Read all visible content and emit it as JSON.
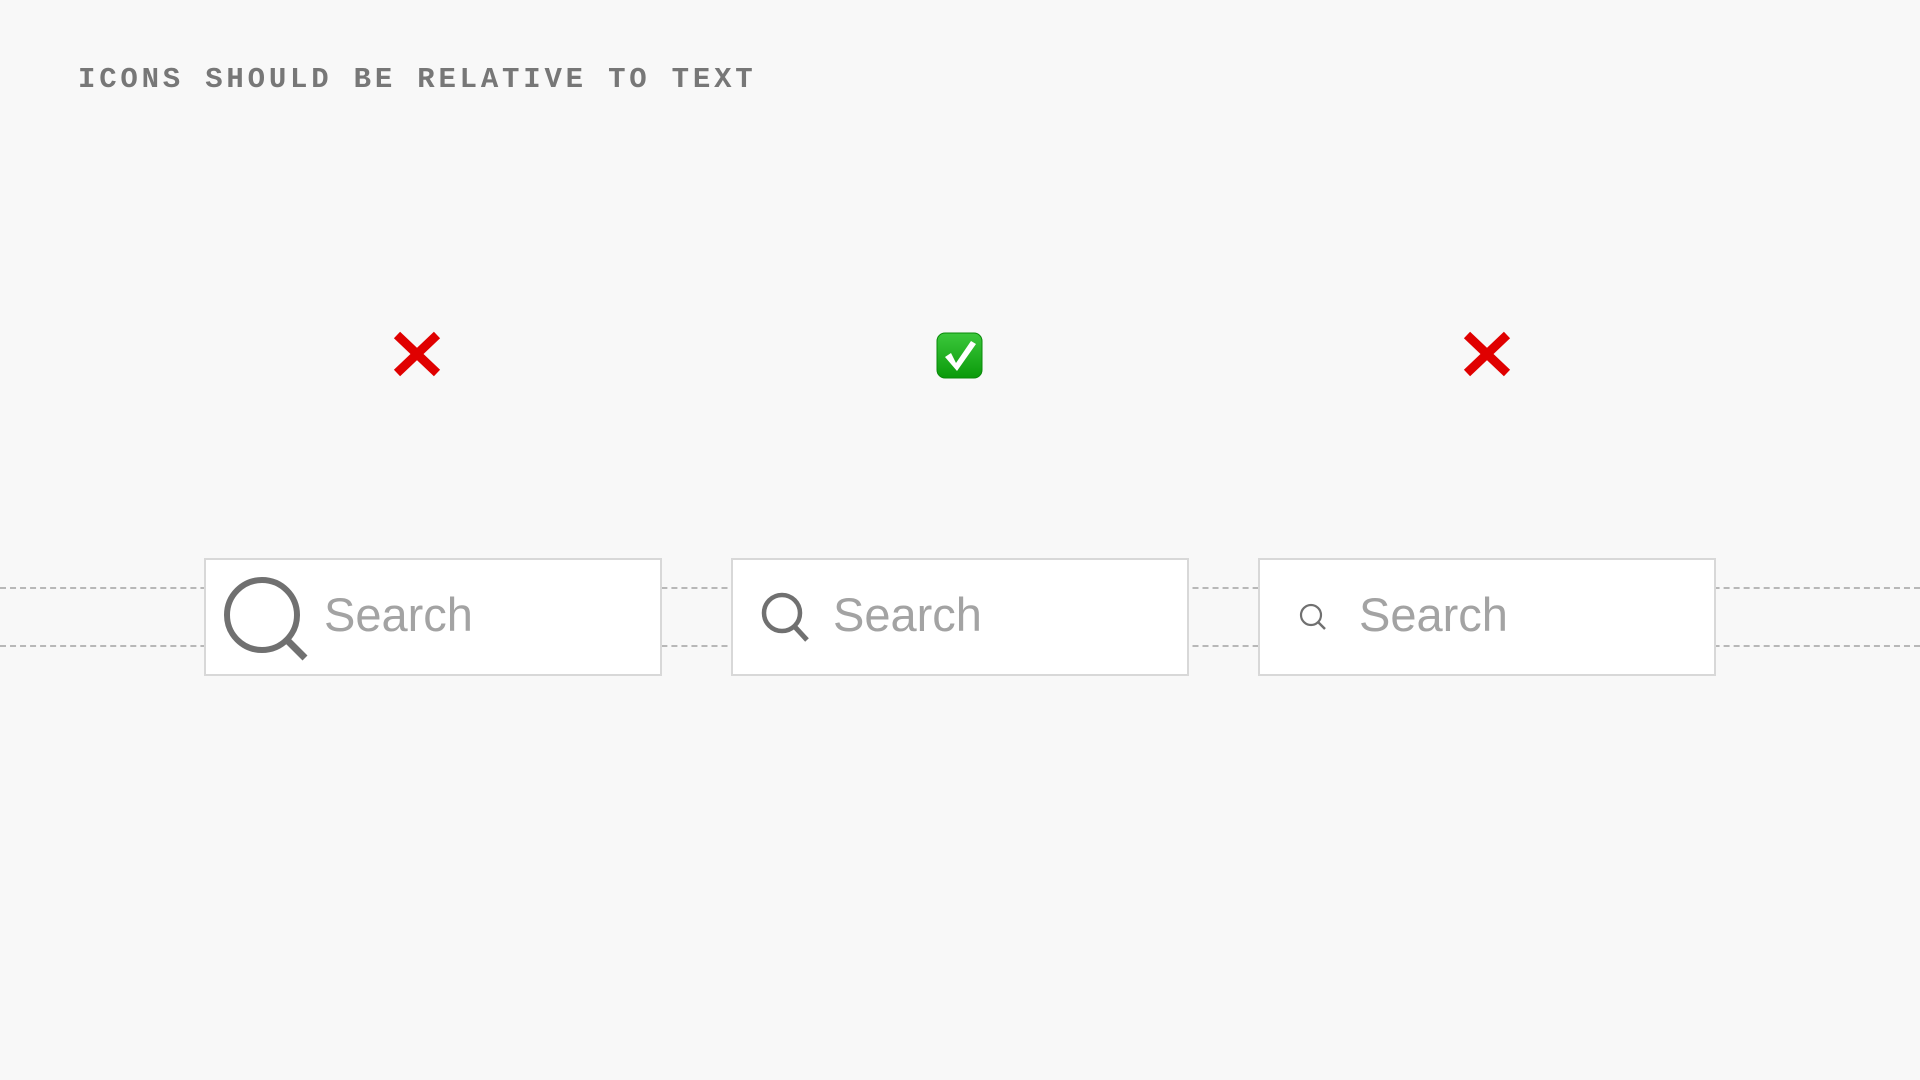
{
  "title": "ICONS SHOULD BE RELATIVE TO TEXT",
  "colors": {
    "background": "#f8f8f8",
    "text_muted": "#777777",
    "placeholder": "#a3a3a3",
    "icon": "#707070",
    "guide_line": "#b8b8b8",
    "box_border": "#d8d8d8",
    "wrong": "#e00000",
    "right": "#1fa81f"
  },
  "examples": [
    {
      "verdict": "wrong",
      "verdict_icon": "cross-mark-icon",
      "icon_size": "too-large",
      "placeholder": "Search"
    },
    {
      "verdict": "correct",
      "verdict_icon": "check-mark-button-icon",
      "icon_size": "relative-to-text",
      "placeholder": "Search"
    },
    {
      "verdict": "wrong",
      "verdict_icon": "cross-mark-icon",
      "icon_size": "too-small",
      "placeholder": "Search"
    }
  ]
}
